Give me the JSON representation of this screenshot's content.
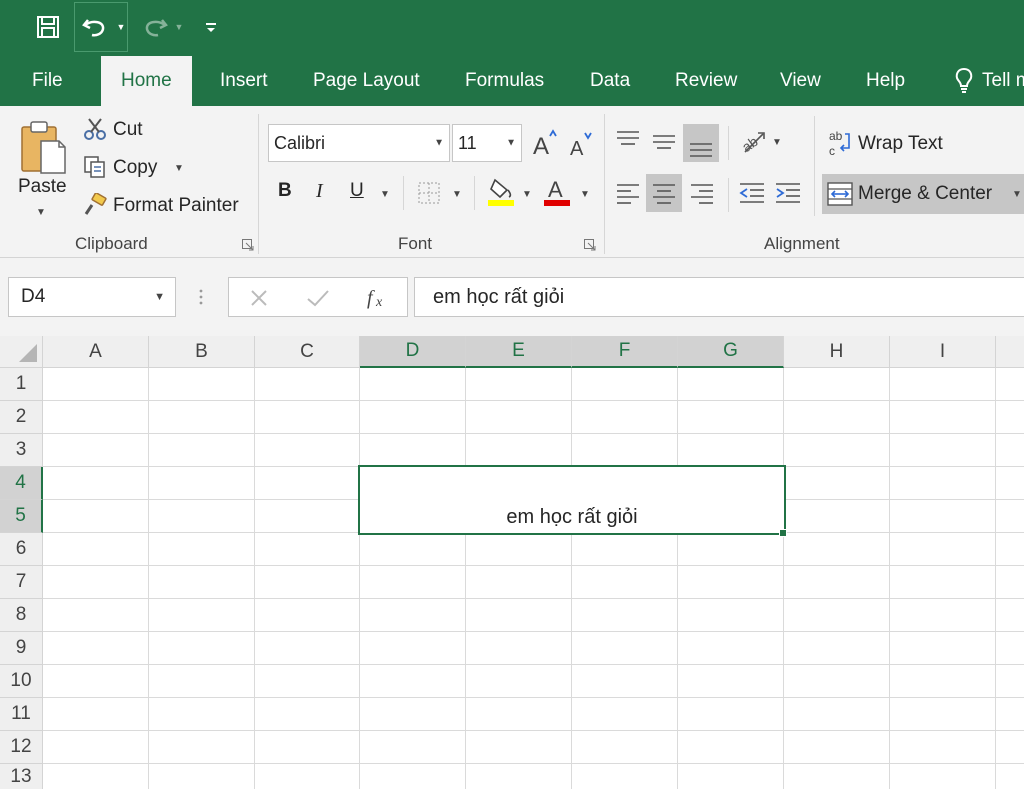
{
  "quick_access": {
    "save_icon": "save-icon",
    "undo_icon": "undo-icon",
    "redo_icon": "redo-icon",
    "customize_icon": "customize-qat-icon"
  },
  "tabs": [
    {
      "label": "File"
    },
    {
      "label": "Home"
    },
    {
      "label": "Insert"
    },
    {
      "label": "Page Layout"
    },
    {
      "label": "Formulas"
    },
    {
      "label": "Data"
    },
    {
      "label": "Review"
    },
    {
      "label": "View"
    },
    {
      "label": "Help"
    },
    {
      "label": "Tell m"
    }
  ],
  "active_tab": "Home",
  "ribbon": {
    "clipboard": {
      "label": "Clipboard",
      "paste": "Paste",
      "cut": "Cut",
      "copy": "Copy",
      "format_painter": "Format Painter"
    },
    "font": {
      "label": "Font",
      "font_name": "Calibri",
      "font_size": "11",
      "bold": "B",
      "italic": "I",
      "underline": "U",
      "highlight_color": "#ffff00",
      "font_color": "#ff0000"
    },
    "alignment": {
      "label": "Alignment",
      "wrap_text": "Wrap Text",
      "merge_center": "Merge & Center"
    }
  },
  "formula_bar": {
    "name_box": "D4",
    "fx": "fx",
    "formula": "em học rất giỏi"
  },
  "sheet": {
    "columns": [
      "A",
      "B",
      "C",
      "D",
      "E",
      "F",
      "G",
      "H",
      "I"
    ],
    "rows": [
      "1",
      "2",
      "3",
      "4",
      "5",
      "6",
      "7",
      "8",
      "9",
      "10",
      "11",
      "12",
      "13"
    ],
    "selected_columns": [
      "D",
      "E",
      "F",
      "G"
    ],
    "selected_rows": [
      "4",
      "5"
    ],
    "merged_cell_value": "em học rất giỏi"
  },
  "colors": {
    "accent": "#217346"
  }
}
